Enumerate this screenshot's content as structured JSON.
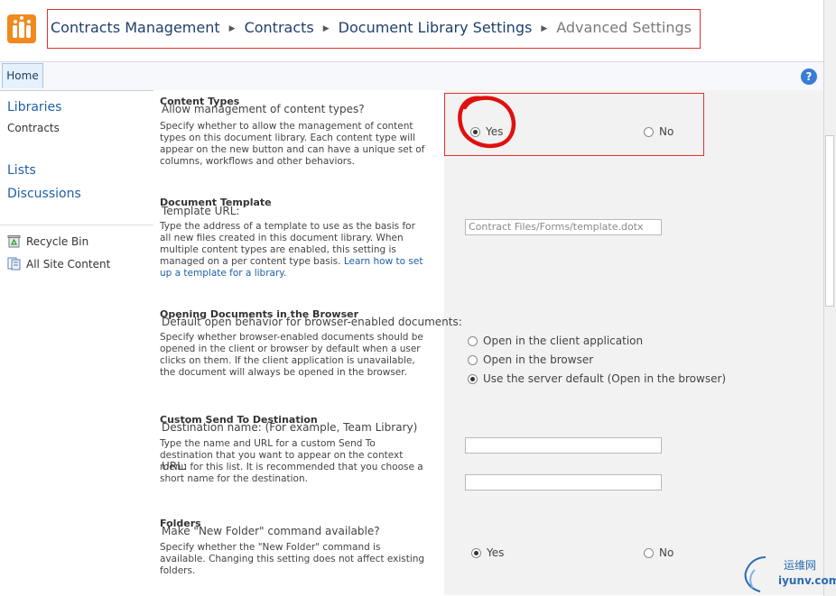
{
  "breadcrumb": {
    "items": [
      "Contracts Management",
      "Contracts",
      "Document Library Settings",
      "Advanced Settings"
    ]
  },
  "ribbon": {
    "home_tab": "Home",
    "help_label": "?"
  },
  "leftnav": {
    "libraries": "Libraries",
    "contracts": "Contracts",
    "lists": "Lists",
    "discussions": "Discussions",
    "recycle_bin": "Recycle Bin",
    "all_site_content": "All Site Content"
  },
  "sections": {
    "content_types": {
      "title": "Content Types",
      "description": "Specify whether to allow the management of content types on this document library. Each content type will appear on the new button and can have a unique set of columns, workflows and other behaviors.",
      "question": "Allow management of content types?",
      "yes_label": "Yes",
      "no_label": "No",
      "selected": "Yes"
    },
    "document_template": {
      "title": "Document Template",
      "description": "Type the address of a template to use as the basis for all new files created in this document library. When multiple content types are enabled, this setting is managed on a per content type basis.",
      "link": "Learn how to set up a template for a library.",
      "url_label": "Template URL:",
      "url_value": "Contract Files/Forms/template.dotx"
    },
    "opening_documents": {
      "title": "Opening Documents in the Browser",
      "description": "Specify whether browser-enabled documents should be opened in the client or browser by default when a user clicks on them. If the client application is unavailable, the document will always be opened in the browser.",
      "question": "Default open behavior for browser-enabled documents:",
      "option_client": "Open in the client application",
      "option_browser": "Open in the browser",
      "option_default": "Use the server default (Open in the browser)",
      "selected": "Use the server default (Open in the browser)"
    },
    "send_to": {
      "title": "Custom Send To Destination",
      "description": "Type the name and URL for a custom Send To destination that you want to appear on the context menu for this list. It is recommended that you choose a short name for the destination.",
      "dest_label": "Destination name: (For example, Team Library)",
      "dest_value": "",
      "url_label": "URL:",
      "url_value": ""
    },
    "folders": {
      "title": "Folders",
      "description": "Specify whether the \"New Folder\" command is available. Changing this setting does not affect existing folders.",
      "question": "Make \"New Folder\" command available?",
      "yes_label": "Yes",
      "no_label": "No",
      "selected": "Yes"
    }
  },
  "watermark": {
    "text_cn": "运维网",
    "text_en": "iyunv.com"
  },
  "colors": {
    "annotation_red": "#e03030",
    "link_blue": "#1e5fa8",
    "logo_orange": "#f08a1e"
  }
}
